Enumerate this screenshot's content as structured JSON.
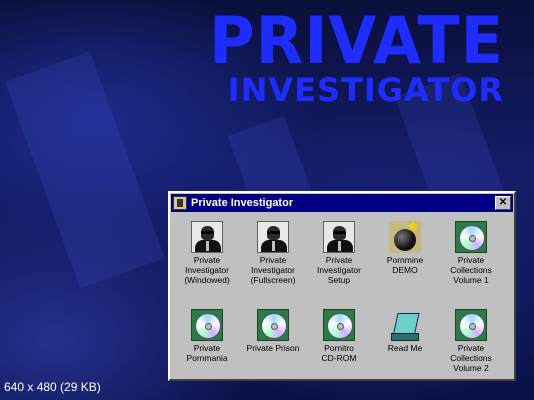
{
  "banner": {
    "line1": "PRIVATE",
    "line2": "INVESTIGATOR"
  },
  "window": {
    "title": "Private Investigator",
    "close_label": "✕",
    "items": [
      {
        "label": "Private\nInvestigator\n(Windowed)",
        "icon": "agent-icon"
      },
      {
        "label": "Private\nInvestigator\n(Fullscreen)",
        "icon": "agent-icon"
      },
      {
        "label": "Private\nInvestigator\nSetup",
        "icon": "agent-icon"
      },
      {
        "label": "Pornmine\nDEMO",
        "icon": "bomb-icon"
      },
      {
        "label": "Private\nCollections\nVolume 1",
        "icon": "cd-icon"
      },
      {
        "label": "Private\nPornmania",
        "icon": "cd-icon"
      },
      {
        "label": "Private Prison",
        "icon": "cd-icon"
      },
      {
        "label": "Pornitro\nCD-ROM",
        "icon": "cd-icon"
      },
      {
        "label": "Read Me",
        "icon": "readme-icon"
      },
      {
        "label": "Private\nCollections\nVolume 2",
        "icon": "cd-icon"
      }
    ]
  },
  "caption": "640 x 480 (29 KB)",
  "colors": {
    "title_blue": "#1f2cff",
    "titlebar": "#000080",
    "window_gray": "#c0c0c0"
  }
}
